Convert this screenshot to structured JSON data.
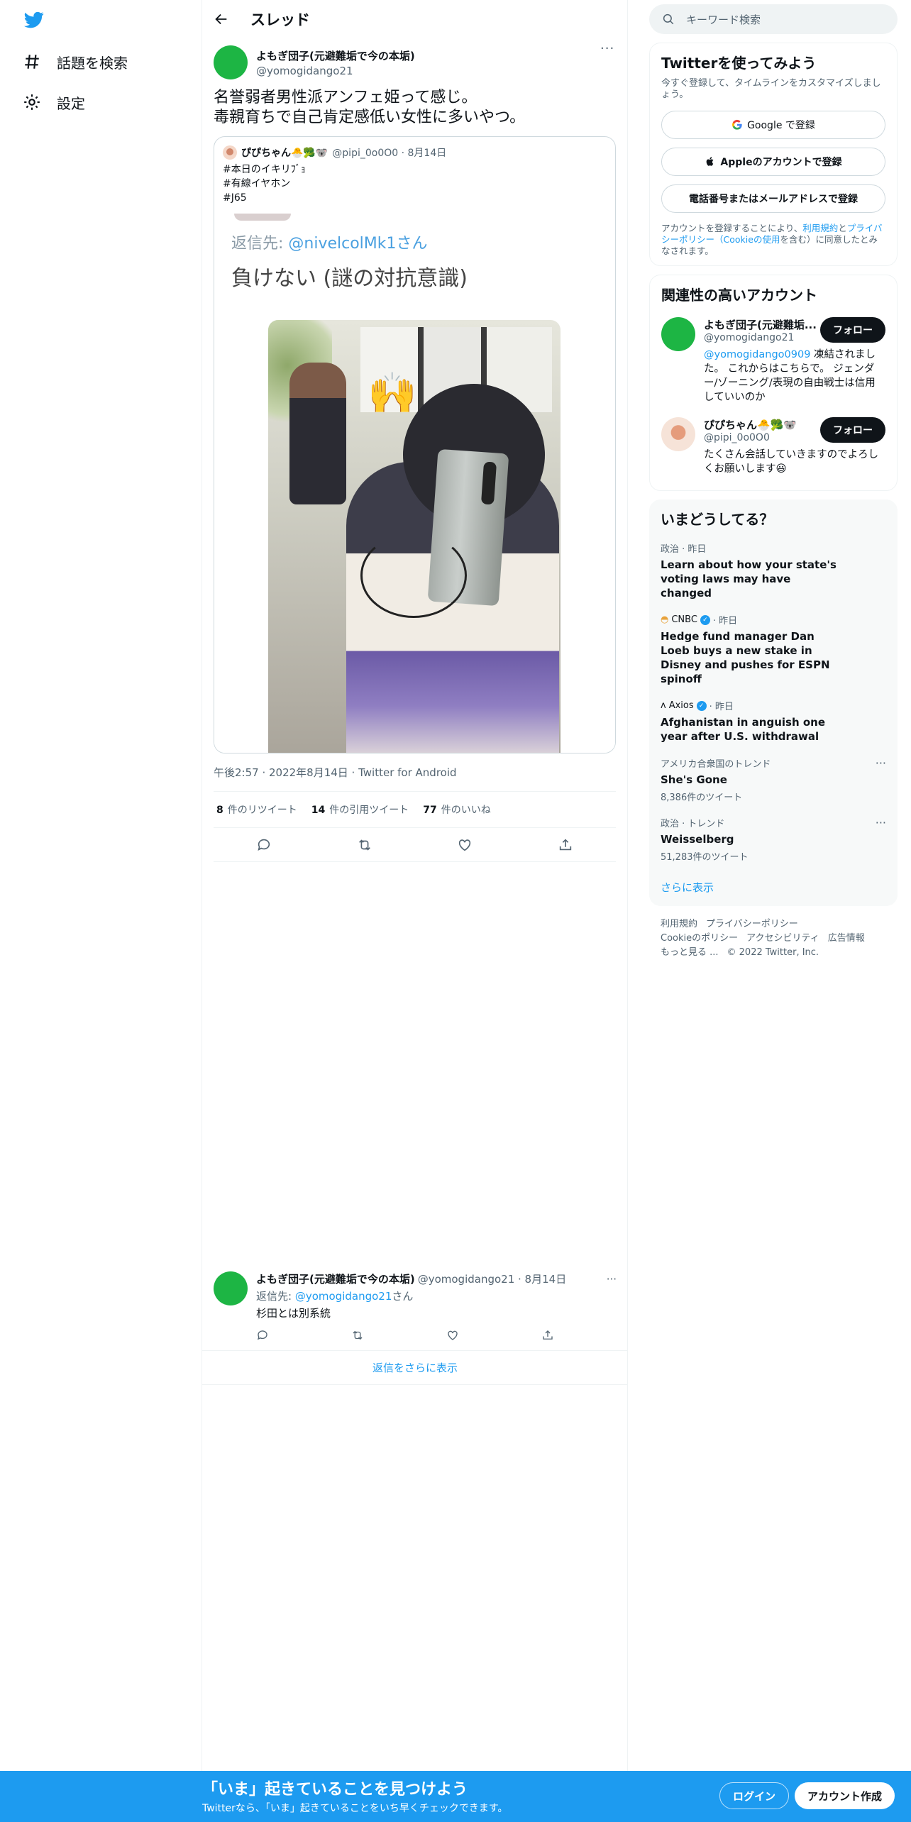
{
  "nav": {
    "explore_label": "話題を検索",
    "settings_label": "設定"
  },
  "header": {
    "title": "スレッド"
  },
  "tweet": {
    "name": "よもぎ団子(元避難垢で今の本垢)",
    "handle": "@yomogidango21",
    "text": "名誉弱者男性派アンフェ姫って感じ。\n毒親育ちで自己肯定感低い女性に多いやつ。",
    "time": "午後2:57 · 2022年8月14日 · Twitter for Android",
    "stats": {
      "retweets_count": "8",
      "retweets_label": "件のリツイート",
      "quotes_count": "14",
      "quotes_label": "件の引用ツイート",
      "likes_count": "77",
      "likes_label": "件のいいね"
    }
  },
  "quote": {
    "name": "ぴぴちゃん🐣🥦🐨",
    "meta": "@pipi_0o0O0 · 8月14日",
    "text": "#本日のイキリﾌﾞｮ\n#有線イヤホン\n#J65",
    "image": {
      "reply_prefix": "返信先: ",
      "reply_handle": "@nivelcolMk1さん",
      "big_text": "負けない (謎の対抗意識)",
      "emoji": "🙌"
    }
  },
  "reply": {
    "name": "よもぎ団子(元避難垢で今の本垢)",
    "meta": "@yomogidango21 · 8月14日",
    "reply_prefix": "返信先: ",
    "reply_handle": "@yomogidango21",
    "reply_suffix": "さん",
    "text": "杉田とは別系統"
  },
  "more_replies": "返信をさらに表示",
  "search": {
    "placeholder": "キーワード検索"
  },
  "signup_card": {
    "title": "Twitterを使ってみよう",
    "sub": "今すぐ登録して、タイムラインをカスタマイズしましょう。",
    "google": "Google で登録",
    "apple": "Appleのアカウントで登録",
    "phone": "電話番号またはメールアドレスで登録",
    "legal_1": "アカウントを登録することにより、",
    "legal_terms": "利用規約",
    "legal_2": "と",
    "legal_privacy": "プライバシーポリシー",
    "legal_cookie": "（Cookieの使用",
    "legal_3": "を含む）に同意したとみなされます。"
  },
  "related": {
    "title": "関連性の高いアカウント",
    "accounts": [
      {
        "name": "よもぎ団子(元避難垢...",
        "handle": "@yomogidango21",
        "follow": "フォロー",
        "bio_link": "@yomogidango0909",
        "bio": " 凍結されました。 これからはこちらで。 ジェンダー/ゾーニング/表現の自由戦士は信用していいのか"
      },
      {
        "name": "ぴぴちゃん🐣🥦🐨",
        "handle": "@pipi_0o0O0",
        "follow": "フォロー",
        "bio_link": "",
        "bio": "たくさん会話していきますのでよろしくお願いします😃"
      }
    ]
  },
  "trends": {
    "title": "いまどうしてる？",
    "items": [
      {
        "source": "",
        "meta": "政治 · 昨日",
        "title": "Learn about how your state's voting laws may have changed",
        "count": ""
      },
      {
        "source": "CNBC",
        "meta": " · 昨日",
        "title": "Hedge fund manager Dan Loeb buys a new stake in Disney and pushes for ESPN spinoff",
        "count": ""
      },
      {
        "source": "Axios",
        "meta": " · 昨日",
        "title": "Afghanistan in anguish one year after U.S. withdrawal",
        "count": ""
      },
      {
        "source": "",
        "meta": "アメリカ合衆国のトレンド",
        "title": "She's Gone",
        "count": "8,386件のツイート"
      },
      {
        "source": "",
        "meta": "政治 · トレンド",
        "title": "Weisselberg",
        "count": "51,283件のツイート"
      }
    ],
    "show_more": "さらに表示"
  },
  "footer": {
    "terms": "利用規約",
    "privacy": "プライバシーポリシー",
    "cookie": "Cookieのポリシー",
    "accessibility": "アクセシビリティ",
    "ads": "広告情報",
    "more": "もっと見る ...",
    "copyright": "© 2022 Twitter, Inc."
  },
  "bottombar": {
    "title": "「いま」起きていることを見つけよう",
    "sub": "Twitterなら、「いま」起きていることをいち早くチェックできます。",
    "login": "ログイン",
    "signup": "アカウント作成"
  },
  "colors": {
    "brand": "#1d9bf0",
    "text": "#0f1419",
    "muted": "#536471"
  }
}
